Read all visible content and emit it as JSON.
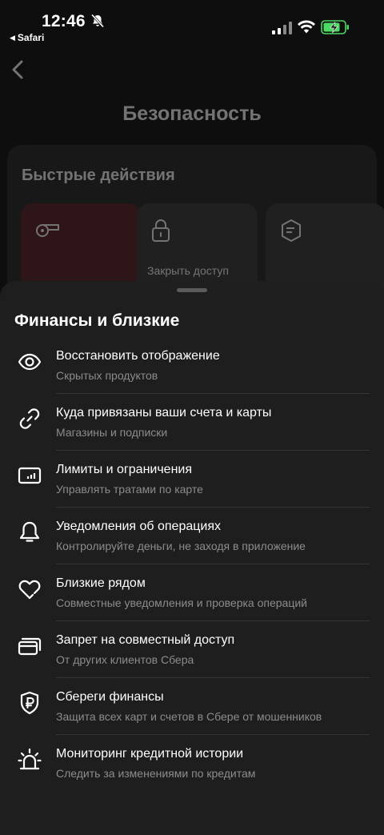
{
  "status_bar": {
    "time": "12:46",
    "back_app": "Safari",
    "icons": [
      "mute-icon",
      "signal-icon",
      "wifi-icon",
      "battery-charging-icon"
    ]
  },
  "background": {
    "title": "Безопасность",
    "quick_actions": {
      "title": "Быстрые действия",
      "tiles": [
        {
          "icon": "whistle-icon",
          "label": ""
        },
        {
          "icon": "lock-icon",
          "label": "Закрыть доступ"
        },
        {
          "icon": "shield-lines-icon",
          "label": ""
        }
      ]
    }
  },
  "sheet": {
    "title": "Финансы и близкие",
    "items": [
      {
        "icon": "eye-icon",
        "title": "Восстановить отображение",
        "subtitle": "Скрытых продуктов"
      },
      {
        "icon": "link-icon",
        "title": "Куда привязаны ваши счета и карты",
        "subtitle": "Магазины и подписки"
      },
      {
        "icon": "limits-chart-icon",
        "title": "Лимиты и ограничения",
        "subtitle": "Управлять тратами по карте"
      },
      {
        "icon": "bell-icon",
        "title": "Уведомления об операциях",
        "subtitle": "Контролируйте деньги, не заходя в приложение"
      },
      {
        "icon": "heart-icon",
        "title": "Близкие рядом",
        "subtitle": "Совместные уведомления и проверка операций"
      },
      {
        "icon": "cards-icon",
        "title": "Запрет на совместный доступ",
        "subtitle": "От других клиентов Сбера"
      },
      {
        "icon": "ruble-shield-icon",
        "title": "Сбереги финансы",
        "subtitle": "Защита всех карт и счетов в Сбере от мошенников"
      },
      {
        "icon": "siren-icon",
        "title": "Мониторинг кредитной истории",
        "subtitle": "Следить за изменениями по кредитам"
      }
    ]
  },
  "colors": {
    "sheet_bg": "#1e1e1e",
    "subtitle": "#8c8c8c",
    "battery_green": "#4cd964",
    "tile_red": "#5a1f24"
  }
}
